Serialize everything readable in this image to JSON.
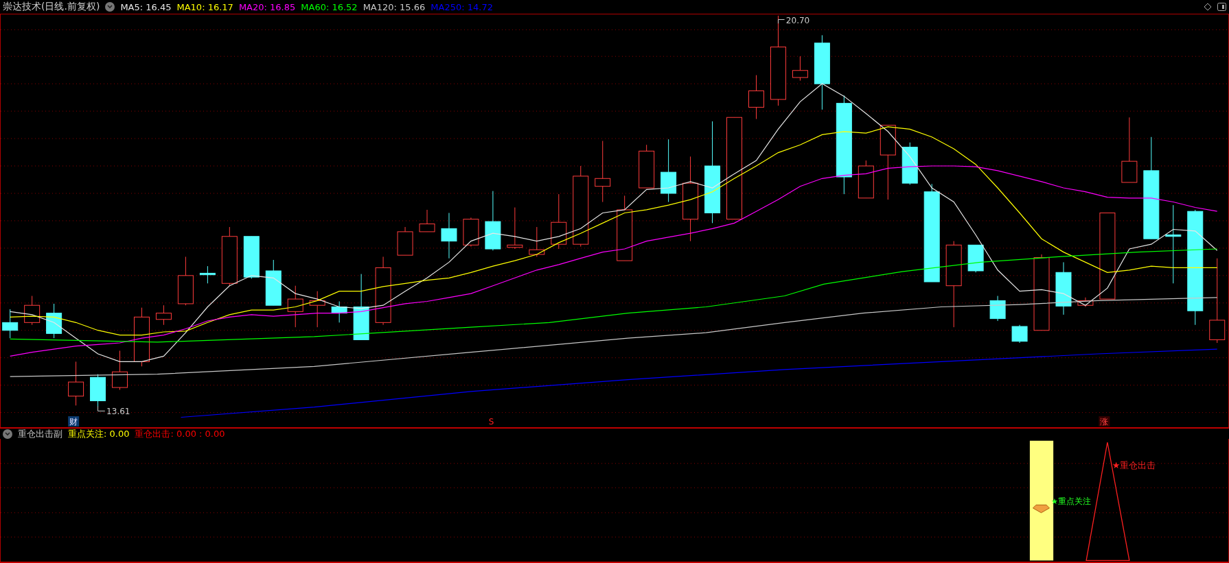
{
  "header": {
    "title": "崇达技术(日线.前复权)",
    "indicators": [
      {
        "label": "MA5: 16.45",
        "color": "#e6e6e6"
      },
      {
        "label": "MA10: 16.17",
        "color": "#ffff00"
      },
      {
        "label": "MA20: 16.85",
        "color": "#ff00ff"
      },
      {
        "label": "MA60: 16.52",
        "color": "#00ff00"
      },
      {
        "label": "MA120: 15.66",
        "color": "#c8c8c8"
      },
      {
        "label": "MA250: 14.72",
        "color": "#0000ff"
      }
    ]
  },
  "main_chart": {
    "high_label": "20.70",
    "low_label": "13.61",
    "markers": [
      {
        "text": "财",
        "kind": "news"
      },
      {
        "text": "S",
        "kind": "sell"
      },
      {
        "text": "涨",
        "kind": "rise"
      }
    ]
  },
  "sub_panel": {
    "title": "重仓出击副",
    "values": [
      {
        "label": "重点关注: 0.00",
        "color": "#ffff00"
      },
      {
        "label": "重仓出击: 0.00 : 0.00",
        "color": "#ff0000"
      }
    ],
    "signals": [
      {
        "kind": "focus",
        "text": "★重点关注"
      },
      {
        "kind": "strike",
        "text": "★重仓出击"
      }
    ]
  }
}
